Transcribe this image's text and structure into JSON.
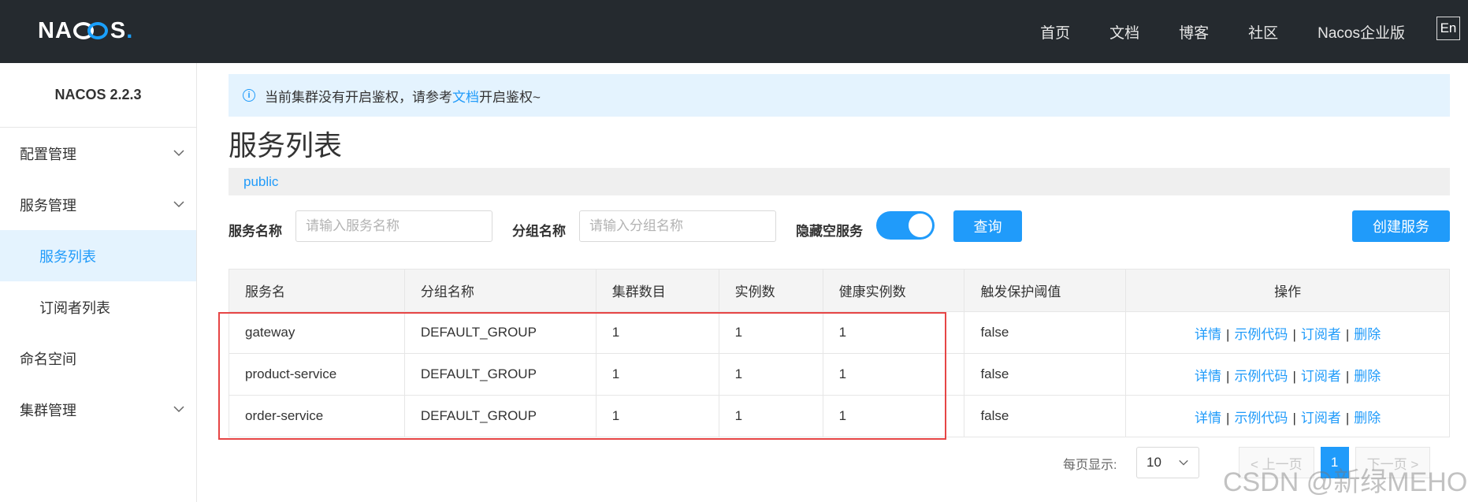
{
  "header": {
    "logo_text": "NACOS.",
    "nav": [
      "首页",
      "文档",
      "博客",
      "社区",
      "Nacos企业版"
    ],
    "lang_button": "En"
  },
  "sidebar": {
    "version": "NACOS 2.2.3",
    "items": [
      {
        "label": "配置管理"
      },
      {
        "label": "服务管理"
      },
      {
        "label": "服务列表"
      },
      {
        "label": "订阅者列表"
      },
      {
        "label": "命名空间"
      },
      {
        "label": "集群管理"
      }
    ]
  },
  "notice": {
    "before": "当前集群没有开启鉴权，请参考",
    "link": "文档",
    "after": "开启鉴权~"
  },
  "page": {
    "title": "服务列表",
    "namespace": "public"
  },
  "filters": {
    "service_name_label": "服务名称",
    "service_name_placeholder": "请输入服务名称",
    "group_name_label": "分组名称",
    "group_name_placeholder": "请输入分组名称",
    "hide_empty_label": "隐藏空服务",
    "hide_empty_on": true,
    "query_button": "查询",
    "create_button": "创建服务"
  },
  "table": {
    "headers": [
      "服务名",
      "分组名称",
      "集群数目",
      "实例数",
      "健康实例数",
      "触发保护阈值",
      "操作"
    ],
    "rows": [
      [
        "gateway",
        "DEFAULT_GROUP",
        "1",
        "1",
        "1",
        "false"
      ],
      [
        "product-service",
        "DEFAULT_GROUP",
        "1",
        "1",
        "1",
        "false"
      ],
      [
        "order-service",
        "DEFAULT_GROUP",
        "1",
        "1",
        "1",
        "false"
      ]
    ],
    "actions": {
      "detail": "详情",
      "sample_code": "示例代码",
      "subscribers": "订阅者",
      "delete": "删除",
      "separator": "|"
    }
  },
  "pagination": {
    "per_page_label": "每页显示:",
    "page_size": "10",
    "prev": "< 上一页",
    "current_page": "1",
    "next": "下一页 >"
  },
  "watermark": "CSDN @新绿MEHO",
  "colors": {
    "primary": "#209bfa",
    "topbar": "#252a2f",
    "highlight_box": "#e64545"
  }
}
